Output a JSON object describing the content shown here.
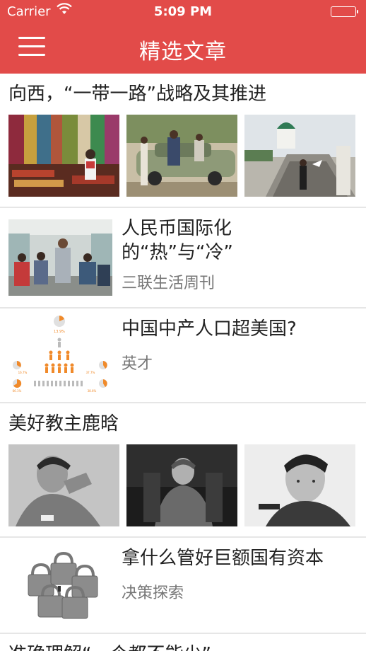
{
  "status_bar": {
    "carrier": "Carrier",
    "time": "5:09 PM"
  },
  "nav": {
    "title": "精选文章",
    "menu_icon": "hamburger-menu-icon"
  },
  "accent_color": "#e24b49",
  "articles": [
    {
      "headline": "向西，“一带一路”战略及其推进"
    },
    {
      "headline_line1": "人民币国际化",
      "headline_line2": "的“热”与“冷”",
      "source": "三联生活周刊"
    },
    {
      "headline": "中国中产人口超美国?",
      "source": "英才",
      "infographic": {
        "top_value": "13.9%",
        "left_mid": "16.7%",
        "right_mid": "37.7%",
        "left_bottom": "66.1%",
        "right_bottom": "38.6%"
      }
    },
    {
      "headline": "美好教主鹿晗"
    },
    {
      "headline": "拿什么管好巨额国有资本",
      "source": "决策探索"
    },
    {
      "headline": "准确理解“一个都不能少”"
    }
  ]
}
